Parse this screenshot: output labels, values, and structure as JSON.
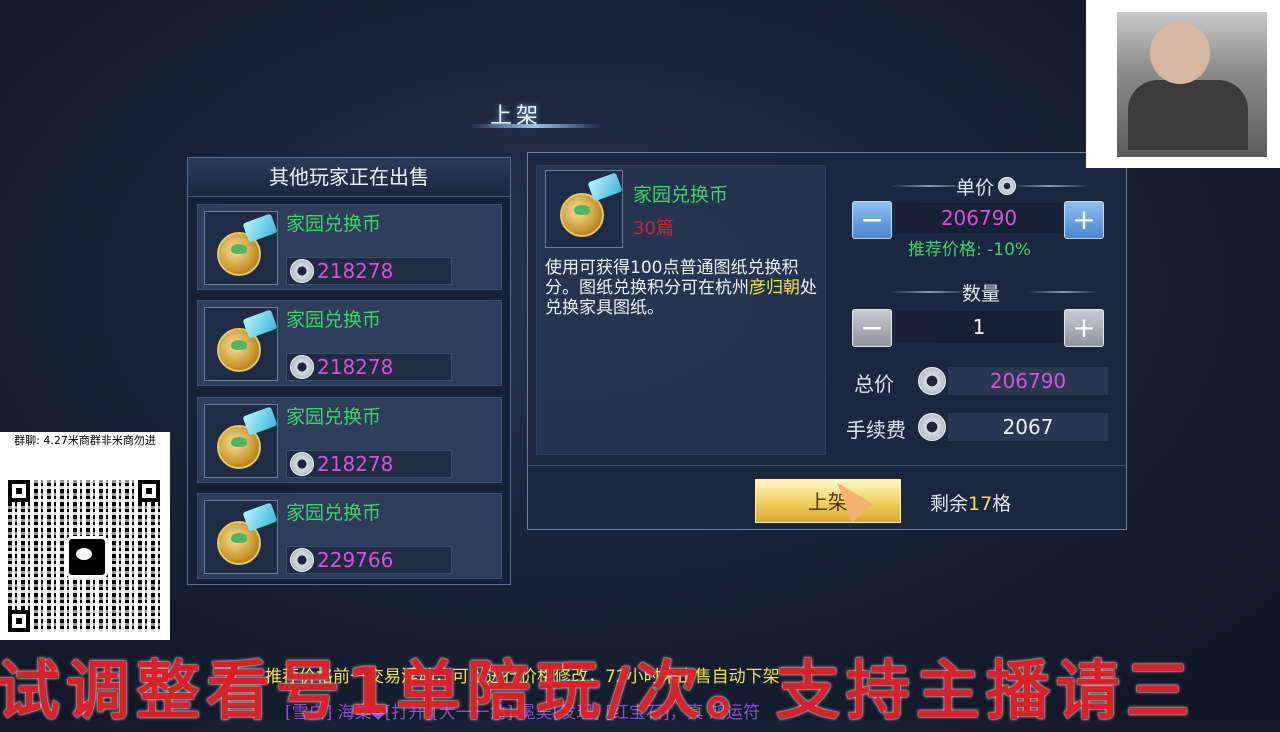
{
  "window_title": "上架",
  "left_panel": {
    "title": "其他玩家正在出售",
    "listings": [
      {
        "name": "家园兑换币",
        "price": "218278"
      },
      {
        "name": "家园兑换币",
        "price": "218278"
      },
      {
        "name": "家园兑换币",
        "price": "218278"
      },
      {
        "name": "家园兑换币",
        "price": "229766"
      }
    ]
  },
  "item_detail": {
    "name": "家园兑换币",
    "time_left": "30篇",
    "description_part1": "使用可获得100点普通图纸兑换积分。图纸兑换积分可在杭州",
    "description_highlight": "彦归朝",
    "description_part2": "处兑换家具图纸。"
  },
  "pricing": {
    "unit_price_label": "单价",
    "unit_price": "206790",
    "recommend_text": "推荐价格: -10%",
    "quantity_label": "数量",
    "quantity": "1",
    "total_label": "总价",
    "total_price": "206790",
    "fee_label": "手续费",
    "fee": "2067",
    "minus_symbol": "−",
    "plus_symbol": "+"
  },
  "actions": {
    "list_button": "上架",
    "remaining_prefix": "剩余",
    "remaining_count": "17",
    "remaining_suffix": "格"
  },
  "qr": {
    "caption": "群聊: 4.27米商群非米商勿进"
  },
  "overlay": {
    "ticker_line": "推荐价格前一交易浮动，可以进行价格修改，72小时未出售自动下架",
    "ticker_line2": "[雪白]  海棠◆[打开][大一一角]  冕吴[发现]  [红宝石]，真 鸿运符",
    "banner": "试调整看号1单陪玩/次。支持主播请三"
  },
  "colors": {
    "item_name": "#3fd16b",
    "price": "#d255d9",
    "highlight": "#f2e24a",
    "expire": "#c0283c",
    "banner": "#e0242c"
  }
}
